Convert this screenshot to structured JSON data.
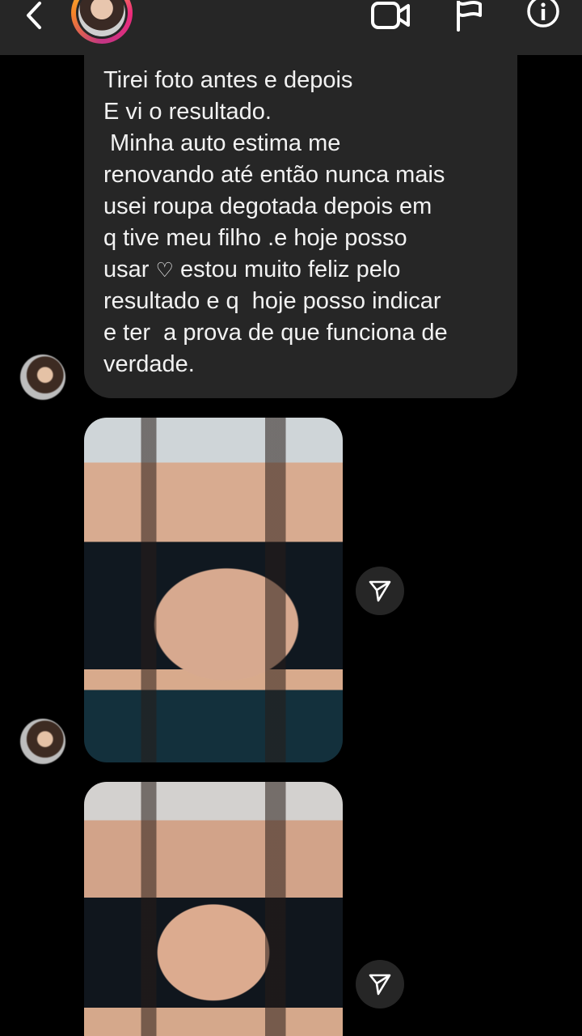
{
  "header": {
    "back_icon": "chevron-left-icon",
    "video_icon": "video-call-icon",
    "flag_icon": "flag-icon",
    "info_icon": "info-icon"
  },
  "message": {
    "lines": [
      "Tirei foto antes e depois",
      "E vi o resultado.",
      " Minha auto estima me",
      "renovando até então nunca mais",
      "usei roupa degotada depois em",
      "q tive meu filho .e hoje posso",
      "usar",
      "estou muito feliz pelo",
      "resultado e q  hoje posso indicar",
      "e ter  a prova de que funciona de",
      "verdade."
    ],
    "heart": "♡"
  },
  "photos": [
    {
      "alt": "photo-before"
    },
    {
      "alt": "photo-after"
    }
  ],
  "colors": {
    "background": "#000000",
    "header": "#262626",
    "bubble": "#262626",
    "text": "#f2f2f2"
  }
}
